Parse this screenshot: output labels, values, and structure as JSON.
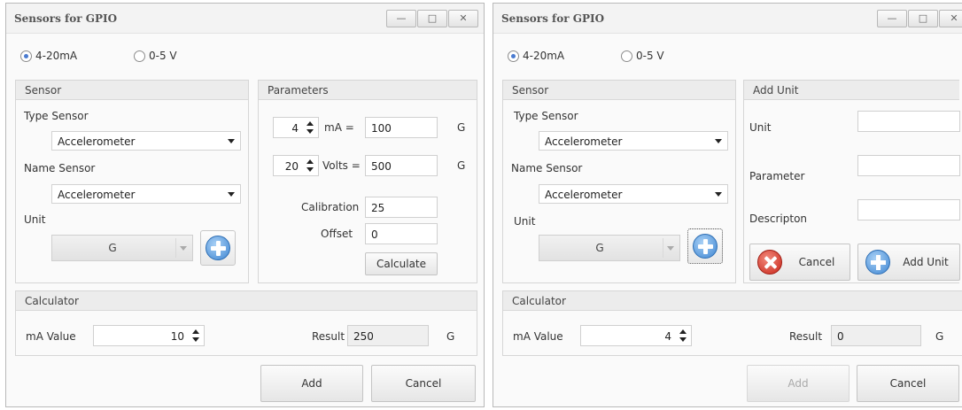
{
  "window_a": {
    "title": "Sensors for GPIO",
    "controls": {
      "minimize": "—",
      "maximize": "□",
      "close": "✕"
    },
    "mode": {
      "option_1": "4-20mA",
      "option_2": "0-5 V",
      "selected": "4-20mA"
    },
    "sensor": {
      "heading": "Sensor",
      "type_label": "Type Sensor",
      "type_value": "Accelerometer",
      "name_label": "Name Sensor",
      "name_value": "Accelerometer",
      "unit_label": "Unit",
      "unit_value": "G"
    },
    "parameters": {
      "heading": "Parameters",
      "row1_value": "4",
      "row1_label": "mA =",
      "row1_result": "100",
      "row1_unit": "G",
      "row2_value": "20",
      "row2_label": "Volts =",
      "row2_result": "500",
      "row2_unit": "G",
      "calibration_label": "Calibration",
      "calibration_value": "25",
      "offset_label": "Offset",
      "offset_value": "0",
      "calculate_label": "Calculate"
    },
    "calculator": {
      "heading": "Calculator",
      "ma_label": "mA Value",
      "ma_value": "10",
      "result_label": "Result",
      "result_value": "250",
      "result_unit": "G"
    },
    "buttons": {
      "add": "Add",
      "cancel": "Cancel"
    }
  },
  "window_b": {
    "title": "Sensors for GPIO",
    "controls": {
      "minimize": "—",
      "maximize": "□",
      "close": "✕"
    },
    "mode": {
      "option_1": "4-20mA",
      "option_2": "0-5 V",
      "selected": "4-20mA"
    },
    "sensor": {
      "heading": "Sensor",
      "type_label": "Type Sensor",
      "type_value": "Accelerometer",
      "name_label": "Name Sensor",
      "name_value": "Accelerometer",
      "unit_label": "Unit",
      "unit_value": "G"
    },
    "add_unit": {
      "heading": "Add Unit",
      "unit_label": "Unit",
      "unit_value": "",
      "parameter_label": "Parameter",
      "parameter_value": "",
      "description_label": "Descripton",
      "description_value": "",
      "cancel_label": "Cancel",
      "add_unit_label": "Add Unit"
    },
    "calculator": {
      "heading": "Calculator",
      "ma_label": "mA Value",
      "ma_value": "4",
      "result_label": "Result",
      "result_value": "0",
      "result_unit": "G"
    },
    "buttons": {
      "add": "Add",
      "cancel": "Cancel"
    }
  },
  "icons": {
    "radio_on": "radio-selected-icon",
    "radio_off": "radio-unselected-icon",
    "add": "add-circle-icon",
    "cancel": "cancel-circle-icon",
    "dropdown": "chevron-down-icon",
    "spin": "spin-arrows-icon"
  }
}
